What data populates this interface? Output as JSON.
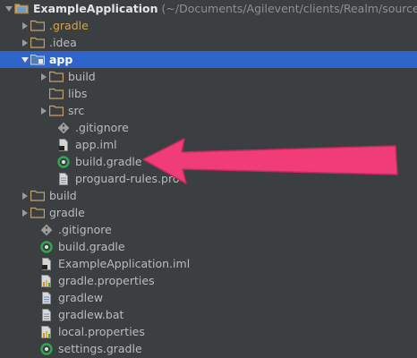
{
  "tree": {
    "root": {
      "label": "ExampleApplication",
      "path": "(~/Documents/Agilevent/clients/Realm/source/scra"
    },
    "rows": [
      {
        "name": "tree-item-gradle-dir",
        "label": ".gradle"
      },
      {
        "name": "tree-item-idea",
        "label": ".idea"
      },
      {
        "name": "tree-item-app",
        "label": "app"
      },
      {
        "name": "tree-item-app-build",
        "label": "build"
      },
      {
        "name": "tree-item-app-libs",
        "label": "libs"
      },
      {
        "name": "tree-item-app-src",
        "label": "src"
      },
      {
        "name": "tree-item-app-gitignore",
        "label": ".gitignore"
      },
      {
        "name": "tree-item-app-iml",
        "label": "app.iml"
      },
      {
        "name": "tree-item-app-build-gradle",
        "label": "build.gradle"
      },
      {
        "name": "tree-item-proguard",
        "label": "proguard-rules.pro"
      },
      {
        "name": "tree-item-build",
        "label": "build"
      },
      {
        "name": "tree-item-gradle",
        "label": "gradle"
      },
      {
        "name": "tree-item-gitignore",
        "label": ".gitignore"
      },
      {
        "name": "tree-item-build-gradle",
        "label": "build.gradle"
      },
      {
        "name": "tree-item-example-iml",
        "label": "ExampleApplication.iml"
      },
      {
        "name": "tree-item-gradle-properties",
        "label": "gradle.properties"
      },
      {
        "name": "tree-item-gradlew",
        "label": "gradlew"
      },
      {
        "name": "tree-item-gradlew-bat",
        "label": "gradlew.bat"
      },
      {
        "name": "tree-item-local-properties",
        "label": "local.properties"
      },
      {
        "name": "tree-item-settings-gradle",
        "label": "settings.gradle"
      }
    ]
  },
  "colors": {
    "background": "#3c3f41",
    "selection": "#2f65ca",
    "annotation_arrow": "#f03c78",
    "folder": "#c4a065",
    "gradle_icon": "#2fa84f"
  }
}
